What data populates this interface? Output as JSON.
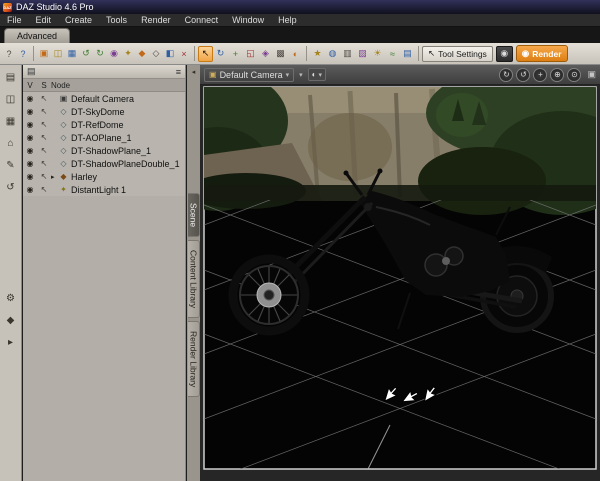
{
  "colors": {
    "accent_orange": "#e8891d",
    "titlebar_bg": "#14142a",
    "toolbar_bg": "#d6d2ca",
    "panel_bg": "#b3afa8",
    "viewport_bg": "#262626",
    "render_button_bg": "#e8891d"
  },
  "titlebar": {
    "logo_text": "DAZ",
    "title": "DAZ Studio 4.6 Pro"
  },
  "menubar": {
    "items": [
      {
        "label": "File"
      },
      {
        "label": "Edit"
      },
      {
        "label": "Create"
      },
      {
        "label": "Tools"
      },
      {
        "label": "Render"
      },
      {
        "label": "Connect"
      },
      {
        "label": "Window"
      },
      {
        "label": "Help"
      }
    ]
  },
  "tabstrip": {
    "active_tab": "Advanced"
  },
  "toolbar": {
    "group1": [
      {
        "name": "context-help-icon",
        "glyph": "?"
      },
      {
        "name": "help-icon",
        "glyph": "?"
      },
      {
        "name": "new-scene-icon",
        "glyph": "▣"
      },
      {
        "name": "open-scene-icon",
        "glyph": "◫"
      },
      {
        "name": "save-scene-icon",
        "glyph": "▦"
      },
      {
        "name": "undo-icon",
        "glyph": "↺"
      },
      {
        "name": "redo-icon",
        "glyph": "↻"
      },
      {
        "name": "create-camera-icon",
        "glyph": "◉"
      },
      {
        "name": "create-light-icon",
        "glyph": "✦"
      },
      {
        "name": "create-primitive-icon",
        "glyph": "◆"
      },
      {
        "name": "create-plane-icon",
        "glyph": "◇"
      },
      {
        "name": "duplicate-node-icon",
        "glyph": "◧"
      },
      {
        "name": "delete-node-icon",
        "glyph": "×"
      }
    ],
    "group2": [
      {
        "name": "node-selection-tool-icon",
        "glyph": "↖"
      },
      {
        "name": "rotate-tool-icon",
        "glyph": "↻"
      },
      {
        "name": "translate-tool-icon",
        "glyph": "+"
      },
      {
        "name": "scale-tool-icon",
        "glyph": "◱"
      },
      {
        "name": "active-pose-tool-icon",
        "glyph": "◈"
      },
      {
        "name": "surface-selection-tool-icon",
        "glyph": "▩"
      },
      {
        "name": "spot-render-tool-icon",
        "glyph": "◐"
      }
    ],
    "group3": [
      {
        "name": "powerpose-icon",
        "glyph": "★"
      },
      {
        "name": "puppeteer-icon",
        "glyph": "◍"
      },
      {
        "name": "timeline-icon",
        "glyph": "▥"
      },
      {
        "name": "shader-mixer-icon",
        "glyph": "▨"
      },
      {
        "name": "lighting-icon",
        "glyph": "☀"
      },
      {
        "name": "smoothing-icon",
        "glyph": "≈"
      },
      {
        "name": "scene-info-icon",
        "glyph": "▤"
      }
    ],
    "tool_settings": {
      "glyph": "↖",
      "label": "Tool Settings"
    },
    "snapshot_glyph": "◉",
    "render": {
      "glyph": "◉",
      "label": "Render"
    }
  },
  "left_rail": {
    "top_icons": [
      {
        "name": "new-file-icon",
        "glyph": "▤"
      },
      {
        "name": "open-file-icon",
        "glyph": "◫"
      },
      {
        "name": "save-file-icon",
        "glyph": "▦"
      },
      {
        "name": "home-icon",
        "glyph": "⌂"
      },
      {
        "name": "edit-icon",
        "glyph": "✎"
      },
      {
        "name": "undo-rail-icon",
        "glyph": "↺"
      }
    ],
    "bottom_icons": [
      {
        "name": "settings-icon",
        "glyph": "⚙"
      },
      {
        "name": "content-icon",
        "glyph": "◆"
      },
      {
        "name": "play-icon",
        "glyph": "▸"
      }
    ]
  },
  "scene_panel": {
    "header": {
      "doc_glyph": "▤",
      "menu_glyph": "≡"
    },
    "columns": {
      "v": "V",
      "s": "S",
      "node": "Node"
    },
    "eye_glyph": "◉",
    "sel_glyph": "↖",
    "collapse_glyph": "◂",
    "nodes": [
      {
        "label": "Default Camera",
        "type_glyph": "▣"
      },
      {
        "label": "DT-SkyDome",
        "type_glyph": "◇"
      },
      {
        "label": "DT-RefDome",
        "type_glyph": "◇"
      },
      {
        "label": "DT-AOPlane_1",
        "type_glyph": "◇"
      },
      {
        "label": "DT-ShadowPlane_1",
        "type_glyph": "◇"
      },
      {
        "label": "DT-ShadowPlaneDouble_1",
        "type_glyph": "◇"
      },
      {
        "label": "Harley",
        "type_glyph": "◆",
        "expander": "▸"
      },
      {
        "label": "DistantLight 1",
        "type_glyph": "✦"
      }
    ],
    "side_tabs": [
      {
        "label": "Scene"
      },
      {
        "label": "Content Library"
      },
      {
        "label": "Render Library"
      }
    ]
  },
  "viewport": {
    "toolbar": {
      "camera_glyph": "▣",
      "camera_label": "Default Camera",
      "dropdown_glyph": "▾",
      "style_glyph": "◐",
      "controls": [
        {
          "name": "orbit-icon",
          "glyph": "↻"
        },
        {
          "name": "bank-icon",
          "glyph": "↺"
        },
        {
          "name": "pan-icon",
          "glyph": "+"
        },
        {
          "name": "zoom-icon",
          "glyph": "⊕"
        },
        {
          "name": "frame-icon",
          "glyph": "⊙"
        }
      ],
      "cube_glyph": "▣"
    }
  }
}
